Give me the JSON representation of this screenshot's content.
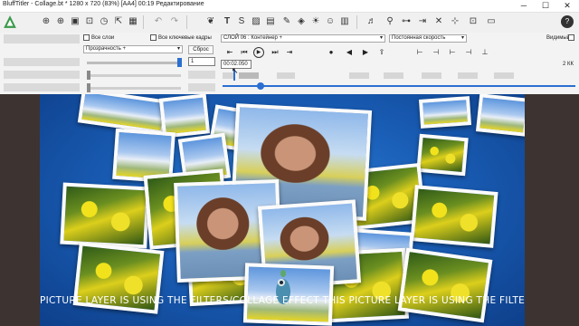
{
  "window": {
    "title": "BluffTitler - Collage.bt * 1280 x 720 (83%) [AA4] 00:19 Редактирование",
    "minimize": "─",
    "maximize": "☐",
    "close": "✕"
  },
  "toolbar": {
    "icons": [
      "logo-icon",
      "new-show-icon",
      "add-layer-icon",
      "save-icon",
      "open-icon",
      "timer-icon",
      "folder-icon",
      "grid-icon",
      "undo-icon",
      "redo-icon",
      "paint-icon",
      "text-layer-icon",
      "s-layer-icon",
      "picture-layer-icon",
      "video-layer-icon",
      "plugin-icon",
      "draw-icon",
      "lightbulb-icon",
      "person-icon",
      "ruler-icon",
      "audio-icon",
      "tool-a-icon",
      "tool-b-icon",
      "tool-c-icon",
      "tool-d-icon",
      "tool-e-icon",
      "tool-f-icon",
      "tool-g-icon",
      "help-icon"
    ],
    "text_t": "T",
    "text_s": "S"
  },
  "panel": {
    "all_layers_label": "Все слои",
    "all_keyframes_label": "Все ключевые кадры",
    "transparency_label": "Прозрачность +",
    "reset_button": "Сброс",
    "layer_select": "СЛОЙ 06   : Контейнер +",
    "speed_select": "Постоянная скорость",
    "visible_label": "Видимый",
    "value_field": "1",
    "time_field": "00:02.050",
    "kk_label": "2 КК"
  },
  "stage": {
    "ticker": "PICTURE LAYER IS USING THE FILTERS/COLLAGE EFFECT    THIS PICTURE LAYER IS USING THE FILTERS/C"
  },
  "colors": {
    "stage_center": "#2f7fd6",
    "stage_edge": "#0e3f8a",
    "slider_blue": "#2b6fd1",
    "backdrop": "#3d3331"
  }
}
